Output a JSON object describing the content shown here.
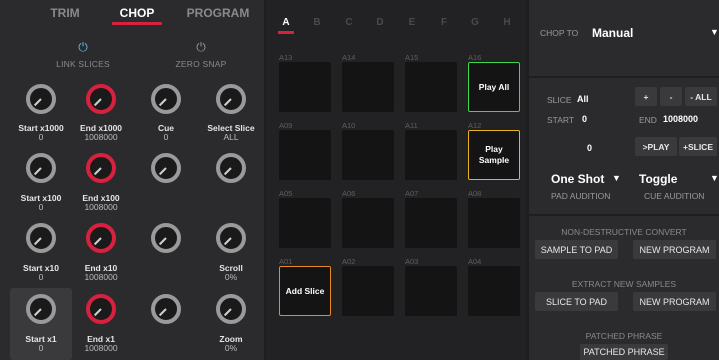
{
  "tabs": [
    "TRIM",
    "CHOP",
    "PROGRAM"
  ],
  "active_tab": "CHOP",
  "toggles": {
    "link_slices": "LINK SLICES",
    "zero_snap": "ZERO SNAP"
  },
  "knobs": {
    "start_1000": {
      "label": "Start x1000",
      "value": "0"
    },
    "end_1000": {
      "label": "End x1000",
      "value": "1008000"
    },
    "cue": {
      "label": "Cue",
      "value": "0"
    },
    "select_slice": {
      "label": "Select Slice",
      "value": "ALL"
    },
    "start_100": {
      "label": "Start x100",
      "value": "0"
    },
    "end_100": {
      "label": "End x100",
      "value": "1008000"
    },
    "start_10": {
      "label": "Start x10",
      "value": "0"
    },
    "end_10": {
      "label": "End x10",
      "value": "1008000"
    },
    "scroll": {
      "label": "Scroll",
      "value": "0%"
    },
    "start_1": {
      "label": "Start x1",
      "value": "0"
    },
    "end_1": {
      "label": "End x1",
      "value": "1008000"
    },
    "zoom": {
      "label": "Zoom",
      "value": "0%"
    }
  },
  "banks": [
    "A",
    "B",
    "C",
    "D",
    "E",
    "F",
    "G",
    "H"
  ],
  "active_bank": "A",
  "pads": {
    "row1": [
      "A13",
      "A14",
      "A15",
      "A16"
    ],
    "row2": [
      "A09",
      "A10",
      "A11",
      "A12"
    ],
    "row3": [
      "A05",
      "A06",
      "A07",
      "A08"
    ],
    "row4": [
      "A01",
      "A02",
      "A03",
      "A04"
    ],
    "play_all": "Play All",
    "play_sample": "Play Sample",
    "add_slice": "Add Slice"
  },
  "pad_colors": {
    "play_all": "#3fd74a",
    "play_sample": "#e8b321",
    "add_slice": "#e88a21"
  },
  "right": {
    "chop_to_label": "CHOP TO",
    "chop_to_value": "Manual",
    "slice_label": "SLICE",
    "slice_value": "All",
    "plus": "+",
    "minus": "-",
    "minus_all": "- ALL",
    "start_label": "START",
    "start_value": "0",
    "end_label": "END",
    "end_value": "1008000",
    "field_value": "0",
    "play_btn": ">PLAY",
    "plus_slice": "+SLICE",
    "pad_audition_value": "One Shot",
    "pad_audition_label": "PAD AUDITION",
    "cue_audition_value": "Toggle",
    "cue_audition_label": "CUE AUDITION",
    "non_destructive": "NON-DESTRUCTIVE CONVERT",
    "sample_to_pad": "SAMPLE TO PAD",
    "new_program": "NEW PROGRAM",
    "extract": "EXTRACT NEW SAMPLES",
    "slice_to_pad": "SLICE TO PAD",
    "new_program2": "NEW PROGRAM",
    "patched_phrase_label": "PATCHED PHRASE",
    "patched_phrase_btn": "PATCHED PHRASE"
  },
  "colors": {
    "accent_red": "#d8213e",
    "link_blue": "#5fb8ea"
  }
}
